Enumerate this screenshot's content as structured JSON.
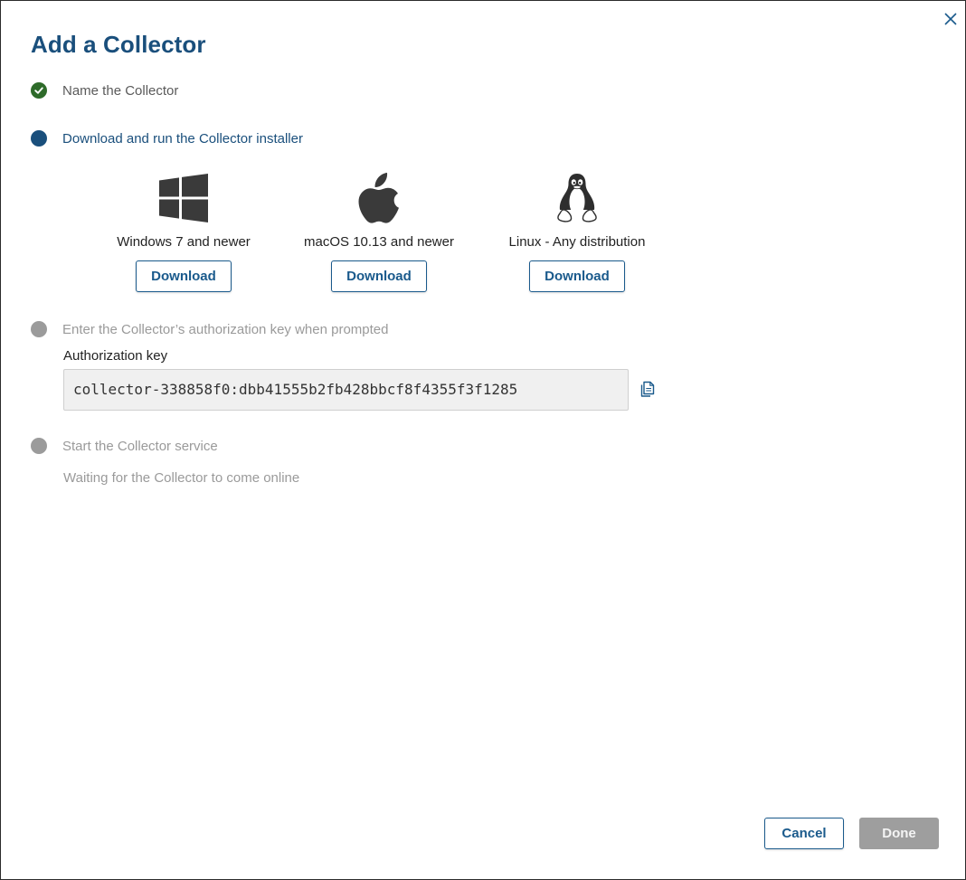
{
  "dialog": {
    "title": "Add a Collector",
    "close_icon": "close-icon"
  },
  "steps": [
    {
      "label": "Name the Collector",
      "state": "done",
      "icon": "check-icon"
    },
    {
      "label": "Download and run the Collector installer",
      "state": "active"
    },
    {
      "label": "Enter the Collector’s authorization key when prompted",
      "state": "pending"
    },
    {
      "label": "Start the Collector service",
      "state": "pending"
    }
  ],
  "downloads": [
    {
      "os": "Windows 7 and newer",
      "icon": "windows-icon",
      "button_label": "Download"
    },
    {
      "os": "macOS 10.13 and newer",
      "icon": "apple-icon",
      "button_label": "Download"
    },
    {
      "os": "Linux - Any distribution",
      "icon": "linux-tux-icon",
      "button_label": "Download"
    }
  ],
  "auth": {
    "label": "Authorization key",
    "value": "collector-338858f0:dbb41555b2fb428bbcf8f4355f3f1285",
    "copy_icon": "copy-icon"
  },
  "status": {
    "waiting_text": "Waiting for the Collector to come online"
  },
  "footer": {
    "cancel_label": "Cancel",
    "done_label": "Done"
  },
  "colors": {
    "primary": "#1a4f7c",
    "success": "#2e6b2a",
    "pending": "#9b9b9b",
    "disabled_button": "#9e9e9e"
  }
}
